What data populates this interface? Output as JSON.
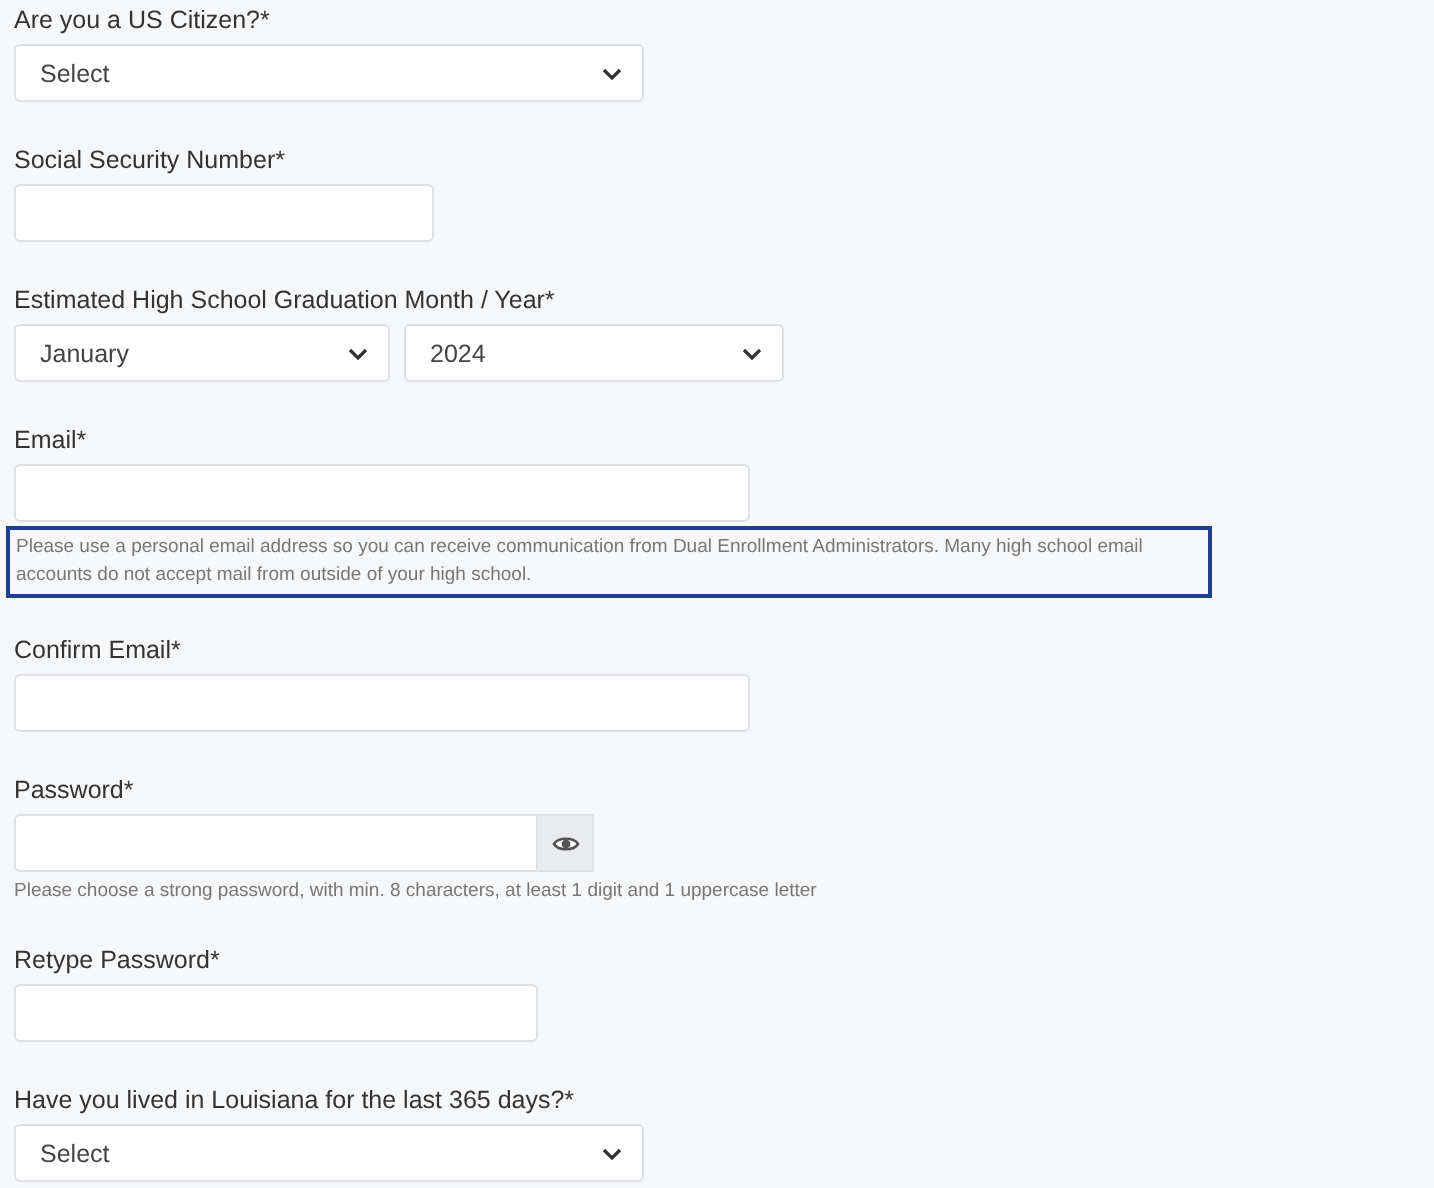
{
  "fields": [
    {
      "kind": "select",
      "label": "Are you a US Citizen?*",
      "value": "Select"
    },
    {
      "kind": "text",
      "label": "Social Security Number*"
    },
    {
      "kind": "select-pair",
      "label": "Estimated High School Graduation Month / Year*",
      "values": [
        "January",
        "2024"
      ]
    },
    {
      "kind": "text",
      "label": "Email*",
      "note": {
        "text": "Please use a personal email address so you can receive communication from Dual Enrollment Administrators. Many high school email accounts do not accept mail from outside of your high school.",
        "highlighted": true
      }
    },
    {
      "kind": "text",
      "label": "Confirm Email*"
    },
    {
      "kind": "password",
      "label": "Password*",
      "hint": "Please choose a strong password, with min. 8 characters, at least 1 digit and 1 uppercase letter"
    },
    {
      "kind": "text",
      "label": "Retype Password*"
    },
    {
      "kind": "select",
      "label": "Have you lived in Louisiana for the last 365 days?*",
      "value": "Select"
    }
  ]
}
